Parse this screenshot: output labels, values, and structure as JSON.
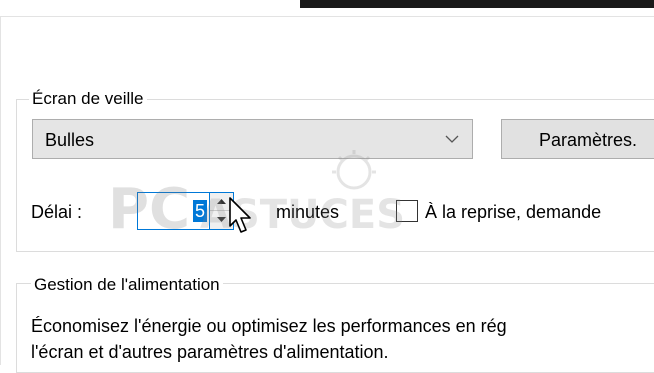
{
  "screensaver": {
    "group_title": "Écran de veille",
    "selected": "Bulles",
    "settings_button": "Paramètres.",
    "delay_label": "Délai :",
    "delay_value": "5",
    "minutes_label": "minutes",
    "resume_checkbox_label": "À la reprise, demande",
    "resume_checked": false
  },
  "power": {
    "group_title": "Gestion de l'alimentation",
    "description_line1": "Économisez l'énergie ou optimisez les performances en rég",
    "description_line2": "l'écran et d'autres paramètres d'alimentation."
  },
  "watermark": {
    "text": "PCASTUCES"
  },
  "colors": {
    "focus": "#0078d7",
    "combo_bg": "#e5e5e5",
    "button_bg": "#e1e1e1"
  }
}
